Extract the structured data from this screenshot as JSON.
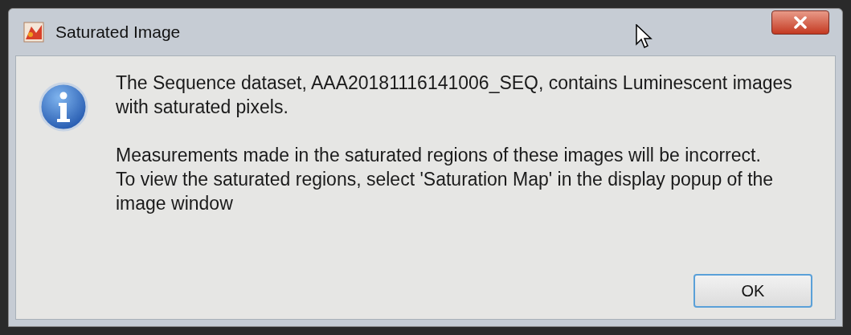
{
  "window": {
    "title": "Saturated Image"
  },
  "message": {
    "paragraphs": [
      [
        "The Sequence dataset, AAA20181116141006_SEQ, contains Luminescent images",
        "with saturated pixels."
      ],
      [
        "Measurements made in the saturated regions of these images will be incorrect.",
        "To view the saturated regions, select 'Saturation Map' in the display popup of the",
        "image window"
      ]
    ]
  },
  "buttons": [
    {
      "label": "OK"
    }
  ]
}
